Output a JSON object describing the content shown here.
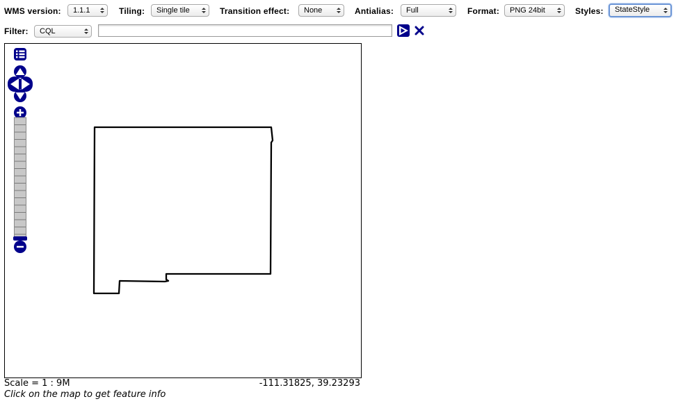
{
  "toolbar": {
    "wms_version": {
      "label": "WMS version:",
      "value": "1.1.1"
    },
    "tiling": {
      "label": "Tiling:",
      "value": "Single tile"
    },
    "transition": {
      "label": "Transition effect:",
      "value": "None"
    },
    "antialias": {
      "label": "Antialias:",
      "value": "Full"
    },
    "format": {
      "label": "Format:",
      "value": "PNG 24bit"
    },
    "styles": {
      "label": "Styles:",
      "value": "StateStyle"
    }
  },
  "filter": {
    "label": "Filter:",
    "type_value": "CQL",
    "text_value": "",
    "apply_icon": "play-icon",
    "reset_icon": "close-icon"
  },
  "map": {
    "layer_switcher_icon": "layers-list-icon",
    "pan_icons": [
      "pan-up-icon",
      "pan-left-icon",
      "pan-right-icon",
      "pan-down-icon"
    ],
    "zoom_in_icon": "zoom-in-icon",
    "zoom_out_icon": "zoom-out-icon",
    "zoom_level_fraction": 0.0,
    "feature": "state-boundary-outline"
  },
  "status": {
    "scale": "Scale = 1 : 9M",
    "coordinates": "-111.31825, 39.23293",
    "info": "Click on the map to get feature info"
  },
  "colors": {
    "control_blue": "#00008b",
    "outline": "#000000",
    "focus_ring": "#6b95d6"
  }
}
